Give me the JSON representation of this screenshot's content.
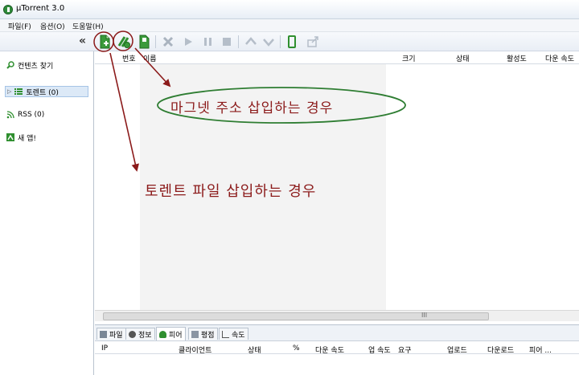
{
  "window": {
    "title": "µTorrent 3.0"
  },
  "menu": {
    "items": [
      "파일(F)",
      "옵션(O)",
      "도움말(H)"
    ]
  },
  "toolbar": {
    "collapse_glyph": "«"
  },
  "sidebar": {
    "items": [
      {
        "label": "컨텐츠 찾기",
        "icon": "search-icon"
      },
      {
        "label": "토렌트 (0)",
        "icon": "torrent-list-icon"
      },
      {
        "label": "RSS (0)",
        "icon": "rss-icon"
      },
      {
        "label": "새 앱!",
        "icon": "apps-icon"
      }
    ]
  },
  "list_columns": [
    "번호",
    "이름",
    "크기",
    "상태",
    "활성도",
    "다운 속도"
  ],
  "bottom_tabs": [
    "파일",
    "정보",
    "피어",
    "평점",
    "속도"
  ],
  "peer_columns": [
    "IP",
    "클라이언트",
    "상태",
    "%",
    "다운 속도",
    "업 속도",
    "요구",
    "업로드",
    "다운로드",
    "피어 ..."
  ],
  "annotations": {
    "magnet": "마그넷 주소 삽입하는 경우",
    "torrent_file": "토렌트 파일 삽입하는 경우"
  },
  "colors": {
    "annotation_red": "#8b1a1a",
    "ellipse_green": "#2e7d32",
    "selection_blue": "#dce9f7"
  },
  "scrollbar_grip": "III"
}
